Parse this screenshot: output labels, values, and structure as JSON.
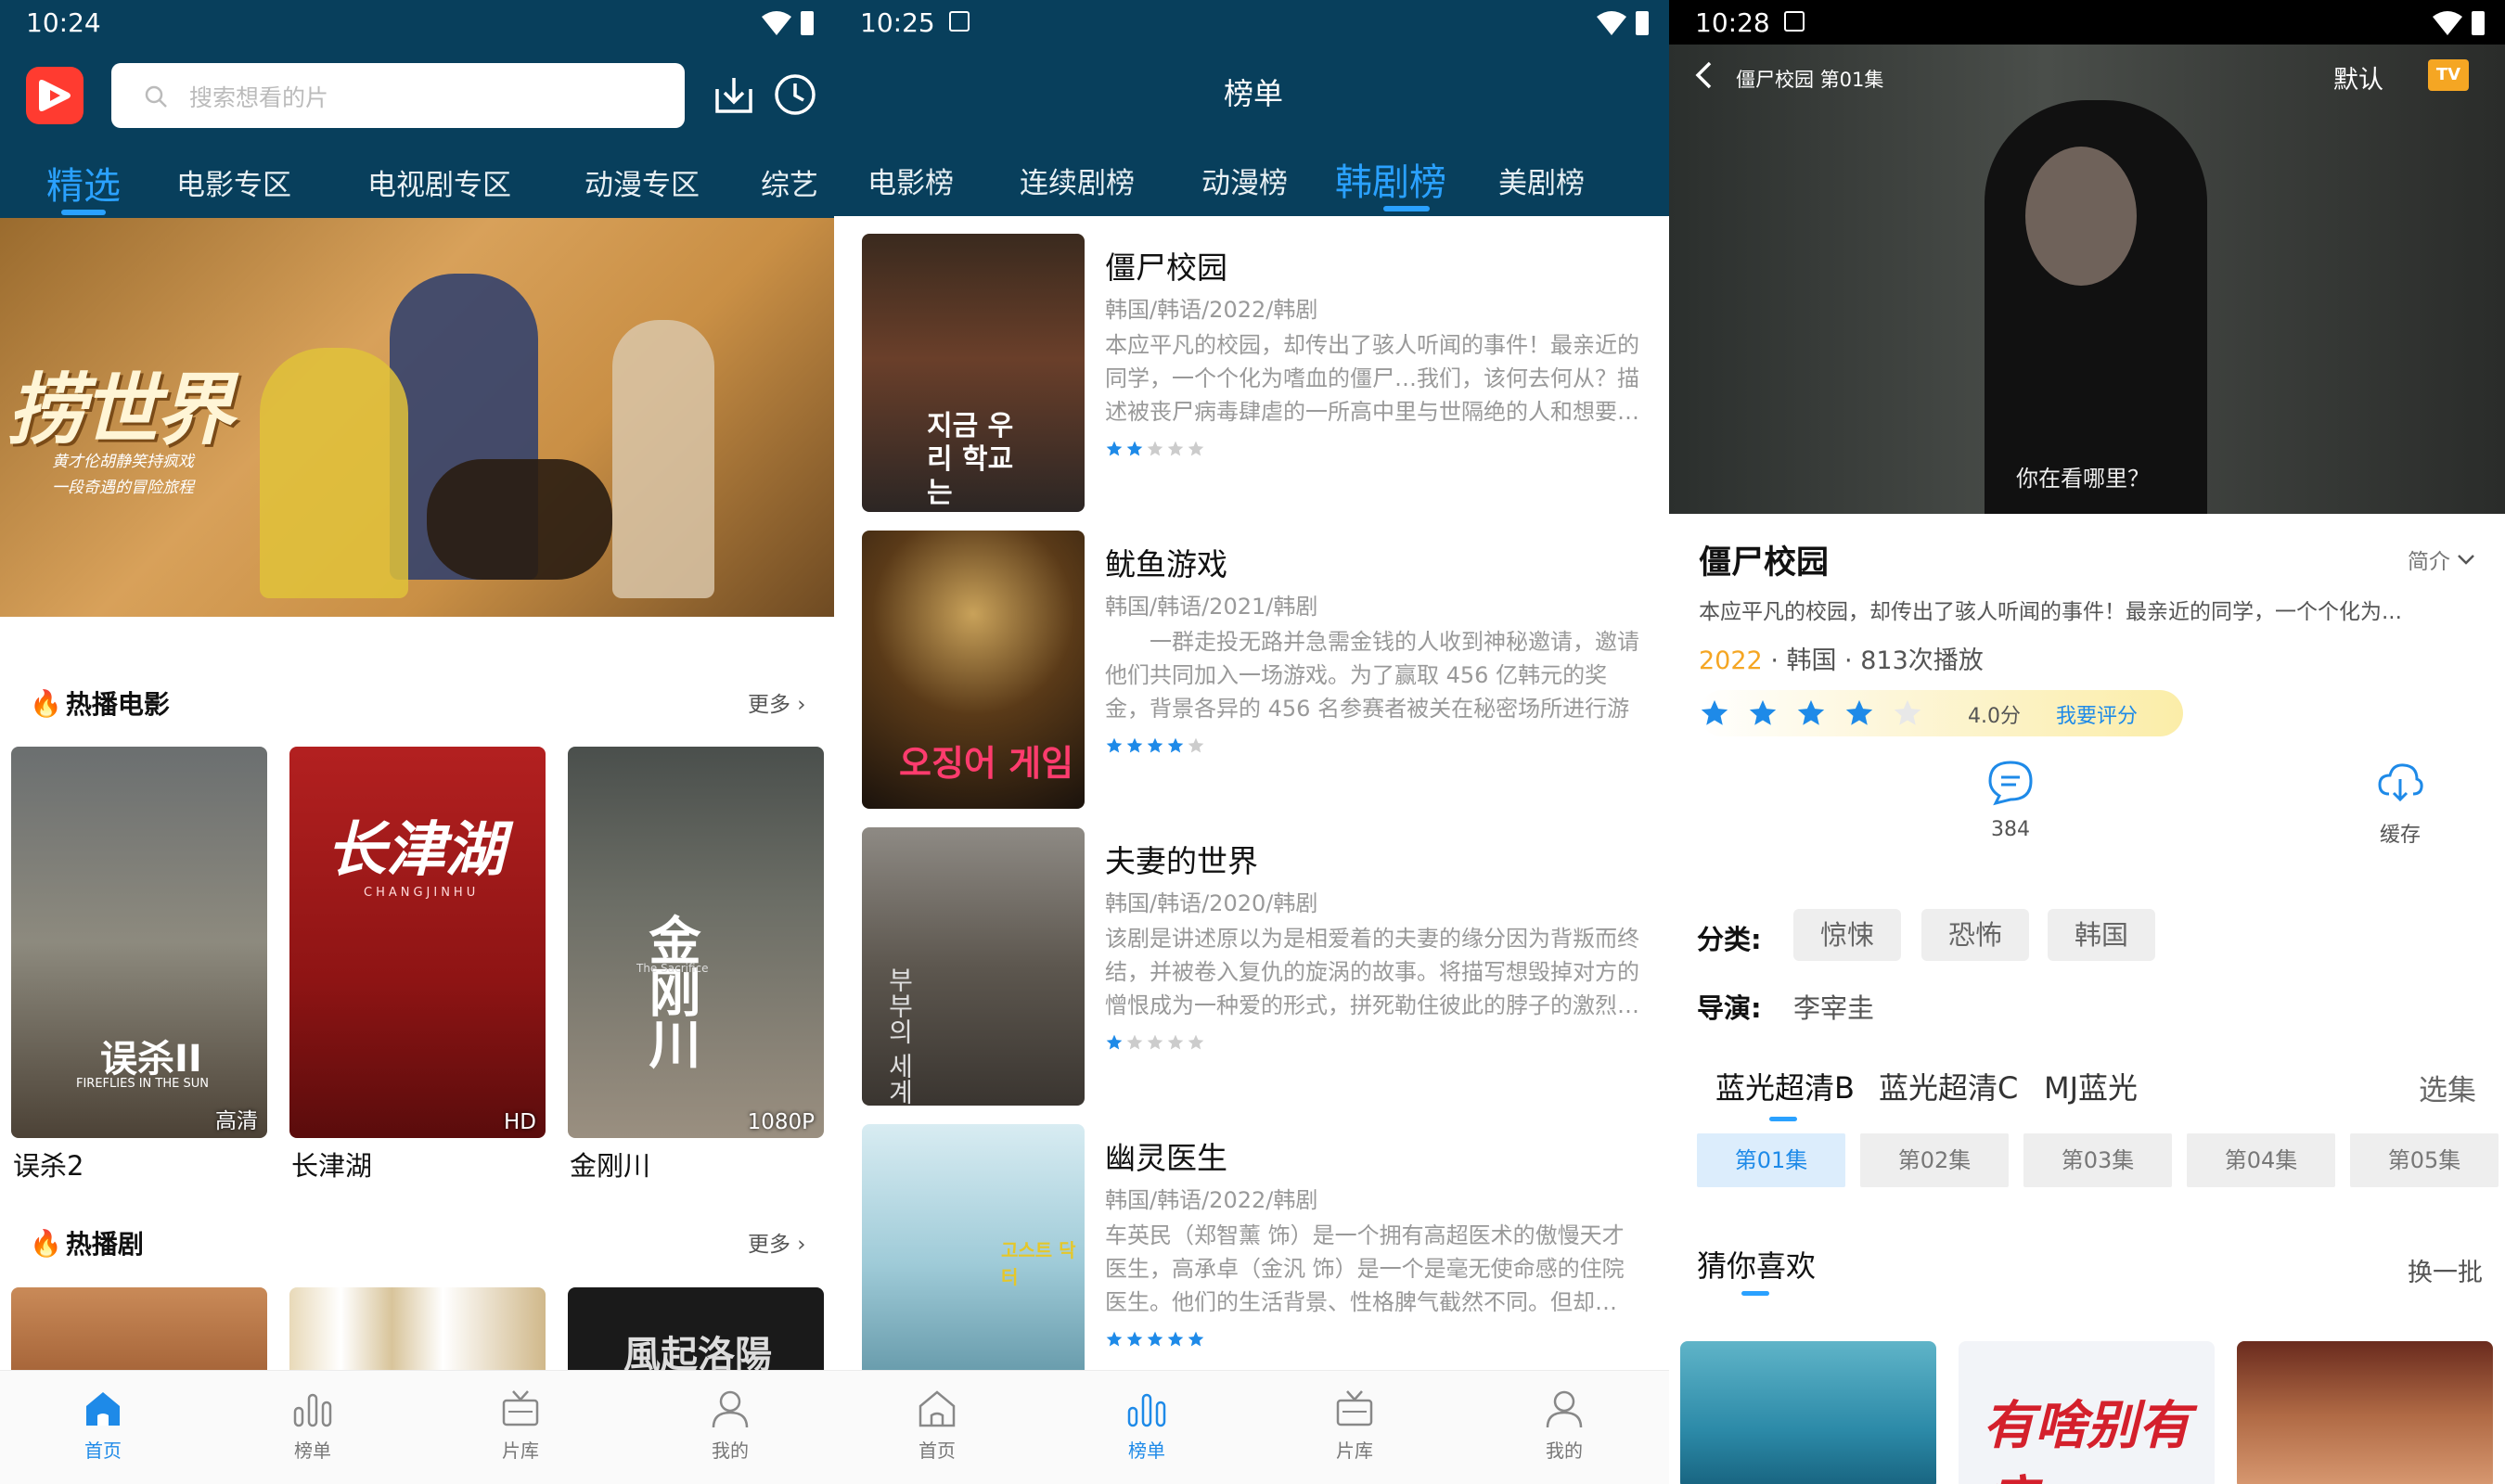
{
  "screen1": {
    "time": "10:24",
    "search_placeholder": "搜索想看的片",
    "tabs": [
      "精选",
      "电影专区",
      "电视剧专区",
      "动漫专区",
      "综艺"
    ],
    "banner_title": "捞世界",
    "banner_sub1": "黄才伦胡静笑持疯戏",
    "banner_sub2": "一段奇遇的冒险旅程",
    "hot_movies_title": "热播电影",
    "hot_series_title": "热播剧",
    "more_label": "更多 ›",
    "movies": [
      {
        "title": "误杀2",
        "badge": "高清",
        "poster_text": "误杀II",
        "poster_sub": "FIREFLIES IN THE SUN"
      },
      {
        "title": "长津湖",
        "badge": "HD",
        "poster_text": "长津湖",
        "poster_sub": "CHANGJINHU"
      },
      {
        "title": "金刚川",
        "badge": "1080P",
        "poster_text": "金刚川",
        "poster_sub": "The Sacrifice"
      }
    ],
    "series_poster_text": "風起洛陽",
    "nav": [
      "首页",
      "榜单",
      "片库",
      "我的"
    ]
  },
  "screen2": {
    "time": "10:25",
    "header_title": "榜单",
    "tabs": [
      "电影榜",
      "连续剧榜",
      "动漫榜",
      "韩剧榜",
      "美剧榜"
    ],
    "items": [
      {
        "title": "僵尸校园",
        "meta": "韩国/韩语/2022/韩剧",
        "desc": "本应平凡的校园，却传出了骇人听闻的事件！最亲近的同学，一个个化为嗜血的僵尸…我们，该何去何从？描述被丧尸病毒肆虐的一所高中里与世隔绝的人和想要…",
        "rating": 2,
        "poster_text": "지금 우리 학교는"
      },
      {
        "title": "鱿鱼游戏",
        "meta": "韩国/韩语/2021/韩剧",
        "desc": "　　一群走投无路并急需金钱的人收到神秘邀请，邀请他们共同加入一场游戏。为了赢取 456 亿韩元的奖金，背景各异的 456 名参赛者被关在秘密场所进行游戏。…",
        "rating": 4,
        "poster_text": "오징어 게임"
      },
      {
        "title": "夫妻的世界",
        "meta": "韩国/韩语/2020/韩剧",
        "desc": "该剧是讲述原以为是相爱着的夫妻的缘分因为背叛而终结，并被卷入复仇的旋涡的故事。将描写想毁掉对方的憎恨成为一种爱的形式，拼死勒住彼此的脖子的激烈…",
        "rating": 1,
        "poster_text": "부부의 세계"
      },
      {
        "title": "幽灵医生",
        "meta": "韩国/韩语/2022/韩剧",
        "desc": "车英民（郑智薰 饰）是一个拥有高超医术的傲慢天才医生，高承卓（金汎 饰）是一个是毫无使命感的住院医生。他们的生活背景、性格脾气截然不同。但却…",
        "rating": 5,
        "poster_text": "고스트 닥터"
      }
    ],
    "nav": [
      "首页",
      "榜单",
      "片库",
      "我的"
    ]
  },
  "screen3": {
    "time": "10:28",
    "video_title": "僵尸校园 第01集",
    "quality": "默认",
    "tv_label": "TV",
    "subtitle": "你在看哪里？",
    "title": "僵尸校园",
    "intro_toggle": "简介",
    "summary": "本应平凡的校园，却传出了骇人听闻的事件！最亲近的同学，一个个化为...",
    "year": "2022",
    "meta_rest": "· 韩国 · 813次播放",
    "rating_value": 4.0,
    "rating_text": "4.0分",
    "rate_action": "我要评分",
    "comments": "384",
    "cache_label": "缓存",
    "category_label": "分类:",
    "categories": [
      "惊悚",
      "恐怖",
      "韩国"
    ],
    "director_label": "导演:",
    "director": "李宰圭",
    "sources": [
      "蓝光超清B",
      "蓝光超清C",
      "MJ蓝光"
    ],
    "select_label": "选集",
    "episodes": [
      "第01集",
      "第02集",
      "第03集",
      "第04集",
      "第05集"
    ],
    "guess_title": "猜你喜欢",
    "refresh_label": "换一批",
    "guess_poster_text": "有啥别有病"
  }
}
